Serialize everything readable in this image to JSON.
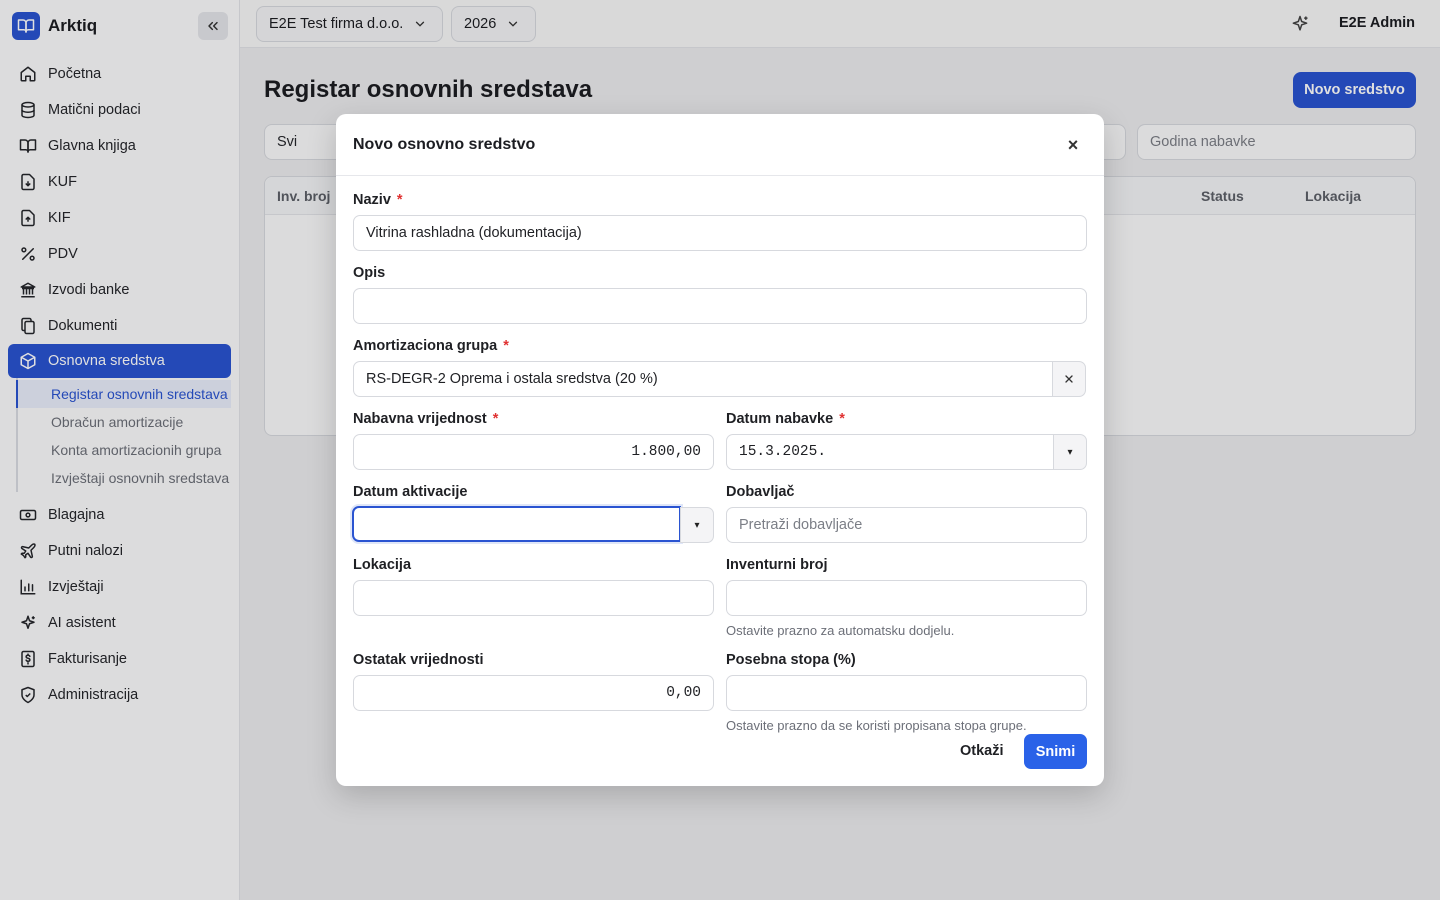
{
  "brand": {
    "name": "Arktiq"
  },
  "sidebar": {
    "items": [
      {
        "label": "Početna",
        "icon": "home-icon"
      },
      {
        "label": "Matični podaci",
        "icon": "database-icon"
      },
      {
        "label": "Glavna knjiga",
        "icon": "book-icon"
      },
      {
        "label": "KUF",
        "icon": "file-download-icon"
      },
      {
        "label": "KIF",
        "icon": "file-upload-icon"
      },
      {
        "label": "PDV",
        "icon": "percent-icon"
      },
      {
        "label": "Izvodi banke",
        "icon": "bank-icon"
      },
      {
        "label": "Dokumenti",
        "icon": "documents-icon"
      },
      {
        "label": "Osnovna sredstva",
        "icon": "box-icon",
        "active": true
      },
      {
        "label": "Blagajna",
        "icon": "cash-icon"
      },
      {
        "label": "Putni nalozi",
        "icon": "plane-icon"
      },
      {
        "label": "Izvještaji",
        "icon": "bar-chart-icon"
      },
      {
        "label": "AI asistent",
        "icon": "sparkle-icon"
      },
      {
        "label": "Fakturisanje",
        "icon": "invoice-icon"
      },
      {
        "label": "Administracija",
        "icon": "shield-icon"
      }
    ],
    "subitems": [
      {
        "label": "Registar osnovnih sredstava",
        "active": true
      },
      {
        "label": "Obračun amortizacije"
      },
      {
        "label": "Konta amortizacionih grupa"
      },
      {
        "label": "Izvještaji osnovnih sredstava"
      }
    ]
  },
  "topbar": {
    "company": "E2E Test firma d.o.o.",
    "year": "2026",
    "user": "E2E Admin"
  },
  "page": {
    "title": "Registar osnovnih sredstava",
    "new_button": "Novo sredstvo",
    "filter_status": "Svi",
    "filter_year_placeholder": "Godina nabavke",
    "columns": [
      "Inv. broj",
      "Status",
      "Lokacija"
    ]
  },
  "modal": {
    "title": "Novo osnovno sredstvo",
    "close": "×",
    "fields": {
      "naziv": {
        "label": "Naziv",
        "value": "Vitrina rashladna (dokumentacija)"
      },
      "opis": {
        "label": "Opis",
        "value": ""
      },
      "amort_grupa": {
        "label": "Amortizaciona grupa",
        "value": "RS-DEGR-2 Oprema i ostala sredstva (20 %)"
      },
      "nabavna": {
        "label": "Nabavna vrijednost",
        "value": "1.800,00"
      },
      "datum_nabavke": {
        "label": "Datum nabavke",
        "value": "15.3.2025."
      },
      "datum_aktivacije": {
        "label": "Datum aktivacije",
        "value": ""
      },
      "dobavljac": {
        "label": "Dobavljač",
        "placeholder": "Pretraži dobavljače"
      },
      "lokacija": {
        "label": "Lokacija",
        "value": ""
      },
      "inventurni": {
        "label": "Inventurni broj",
        "value": "",
        "hint": "Ostavite prazno za automatsku dodjelu."
      },
      "ostatak": {
        "label": "Ostatak vrijednosti",
        "value": "0,00"
      },
      "stopa": {
        "label": "Posebna stopa (%)",
        "value": "",
        "hint": "Ostavite prazno da se koristi propisana stopa grupe."
      }
    },
    "required_mark": "*",
    "cancel": "Otkaži",
    "save": "Snimi"
  },
  "colors": {
    "accent": "#2a54d1",
    "required": "#e03131"
  }
}
